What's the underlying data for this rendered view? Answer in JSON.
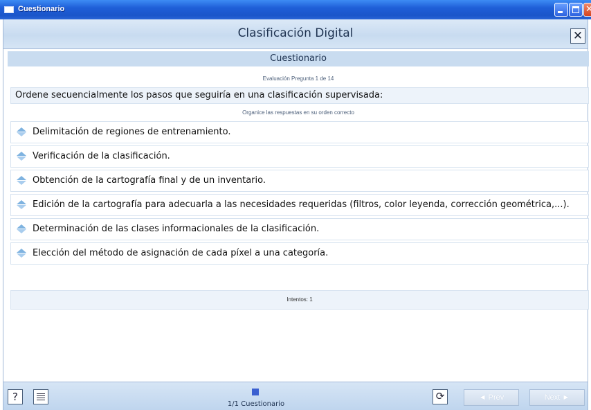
{
  "window": {
    "title": "Cuestionario"
  },
  "header": {
    "title": "Clasificación Digital",
    "close_label": "✕"
  },
  "section": {
    "title": "Cuestionario"
  },
  "evaluation": {
    "label": "Evaluación Pregunta 1 de 14"
  },
  "question": {
    "text": "Ordene secuencialmente los pasos que seguiría en una clasificación supervisada:"
  },
  "instruction": {
    "text": "Organice las respuestas en su orden correcto"
  },
  "answers": [
    "Delimitación de regiones de entrenamiento.",
    "Verificación de la clasificación.",
    "Obtención de la cartografía final y de un inventario.",
    "Edición de la cartografía para adecuarla a las necesidades requeridas (filtros, color leyenda, corrección geométrica,...).",
    "Determinación de las clases informacionales de la clasificación.",
    "Elección del método de asignación de cada píxel a una categoría."
  ],
  "attempts": {
    "label": "Intentos: 1"
  },
  "footer": {
    "help_label": "?",
    "refresh_label": "⟳",
    "progress_text": "1/1 Cuestionario",
    "prev_label": "◄ Prev",
    "next_label": "Next ►"
  },
  "icons": {
    "window": "window-icon",
    "help": "help-icon",
    "list": "list-icon",
    "refresh": "refresh-icon",
    "drag": "drag-handle-icon"
  },
  "colors": {
    "titlebar": "#1f5fd8",
    "header": "#c8dbf0",
    "accent": "#3a5fd0"
  }
}
